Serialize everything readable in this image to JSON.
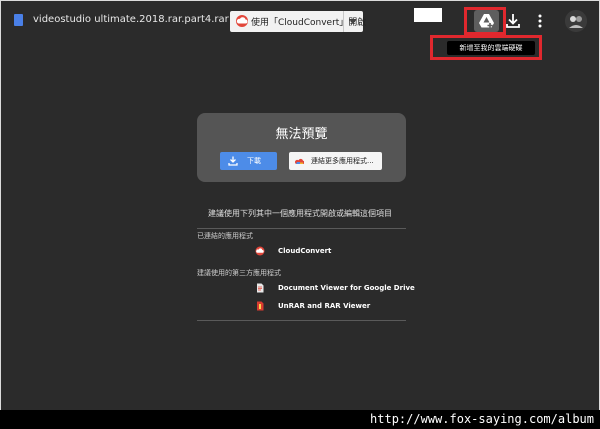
{
  "header": {
    "file_name": "videostudio ultimate.2018.rar.part4.rar",
    "open_with_label": "使用「CloudConvert」開啟"
  },
  "tooltip": {
    "text": "新增至我的雲端硬碟"
  },
  "preview": {
    "title": "無法預覽",
    "download_label": "下載",
    "connect_more_label": "連結更多應用程式..."
  },
  "suggestions": {
    "headline": "建議使用下列其中一個應用程式開啟或編輯這個項目",
    "connected_heading": "已連結的應用程式",
    "connected_apps": [
      {
        "name": "CloudConvert"
      }
    ],
    "third_party_heading": "建議使用的第三方應用程式",
    "third_party_apps": [
      {
        "name": "Document Viewer for Google Drive"
      },
      {
        "name": "UnRAR and RAR Viewer"
      }
    ]
  },
  "watermark": {
    "text": "http://www.fox-saying.com/album"
  },
  "colors": {
    "accent_blue": "#4d8ce8",
    "highlight_red": "#e0282e",
    "background": "#2b2b2b"
  },
  "icons": [
    "file-icon",
    "cloud-icon",
    "chevron-down-icon",
    "add-to-drive-icon",
    "download-icon",
    "more-vert-icon",
    "avatar"
  ]
}
